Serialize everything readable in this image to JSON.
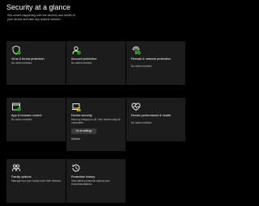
{
  "page": {
    "title": "Security at a glance",
    "subtitle": "See what's happening with the security and health of your device and take any actions needed."
  },
  "colors": {
    "ok": "#16c60c",
    "warning": "#f9c80e",
    "icon": "#ffffff",
    "tile": "#1c1c1c"
  },
  "tiles": [
    {
      "name": "Virus & threat protection",
      "desc": "No action needed.",
      "icon": "shield-icon",
      "status": "ok"
    },
    {
      "name": "Account protection",
      "desc": "No action needed.",
      "icon": "person-icon",
      "status": "ok"
    },
    {
      "name": "Firewall & network protection",
      "desc": "No action needed.",
      "icon": "wifi-signal-icon",
      "status": "ok"
    },
    {
      "name": "App & browser control",
      "desc": "No action needed.",
      "icon": "app-window-icon",
      "status": "ok"
    },
    {
      "name": "Device security",
      "desc": "Memory integrity is off. Your device may be vulnerable.",
      "icon": "laptop-icon",
      "status": "warning",
      "button": "Go to settings",
      "link": "Dismiss"
    },
    {
      "name": "Device performance & health",
      "desc": "No action needed.",
      "icon": "heart-pulse-icon",
      "status": "ok"
    },
    {
      "name": "Family options",
      "desc": "Manage how your family uses their devices.",
      "icon": "family-icon",
      "status": "none"
    },
    {
      "name": "Protection history",
      "desc": "View latest protection actions and recommendations.",
      "icon": "history-icon",
      "status": "none"
    }
  ]
}
